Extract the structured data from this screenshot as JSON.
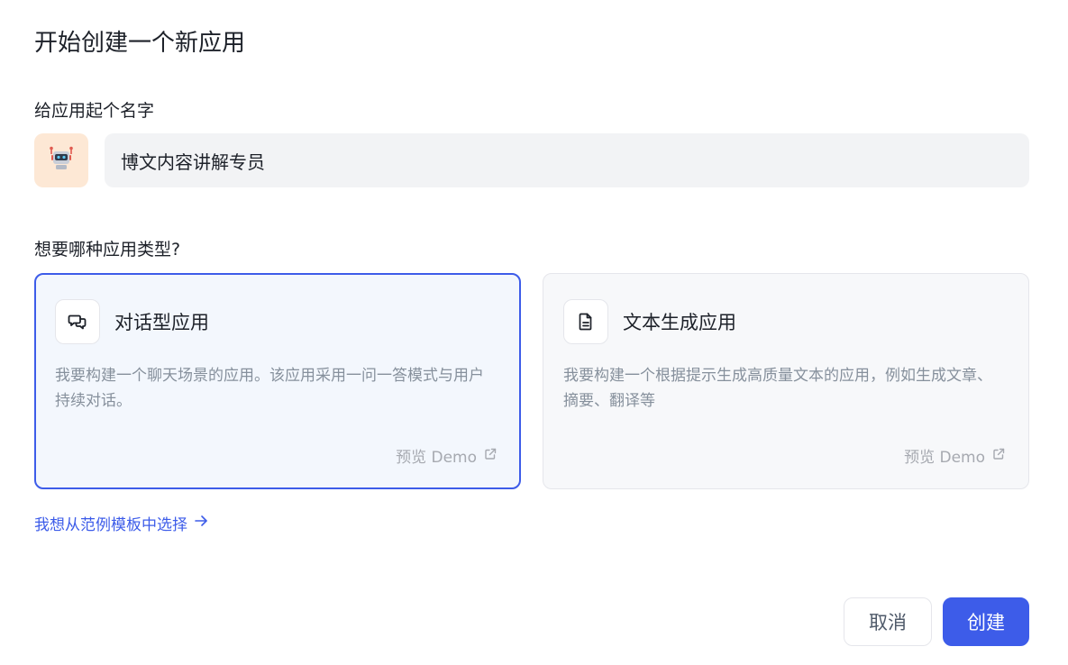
{
  "dialog": {
    "title": "开始创建一个新应用"
  },
  "name_section": {
    "label": "给应用起个名字",
    "avatar_icon": "robot-icon",
    "input_value": "博文内容讲解专员"
  },
  "type_section": {
    "label": "想要哪种应用类型?",
    "cards": [
      {
        "icon": "chat-bubbles-icon",
        "name": "对话型应用",
        "description": "我要构建一个聊天场景的应用。该应用采用一问一答模式与用户持续对话。",
        "demo_label": "预览 Demo",
        "selected": true
      },
      {
        "icon": "document-icon",
        "name": "文本生成应用",
        "description": "我要构建一个根据提示生成高质量文本的应用，例如生成文章、摘要、翻译等",
        "demo_label": "预览 Demo",
        "selected": false
      }
    ]
  },
  "template_link": {
    "label": "我想从范例模板中选择"
  },
  "footer": {
    "cancel_label": "取消",
    "create_label": "创建"
  },
  "colors": {
    "accent": "#3d5ce9",
    "avatar_bg": "#fde8d5",
    "input_bg": "#f2f3f5"
  }
}
